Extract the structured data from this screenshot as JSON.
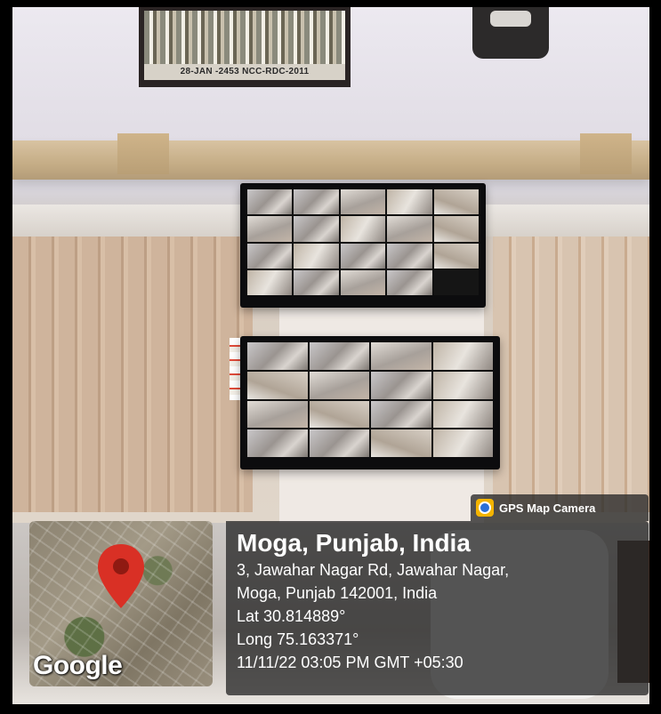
{
  "photo": {
    "frame_caption": "28-JAN -2453   NCC-RDC-2011"
  },
  "overlay": {
    "app_name": "GPS Map Camera",
    "app_icon": "gps-map-camera-icon",
    "map_attribution": "Google",
    "place": "Moga, Punjab, India",
    "address_line_1": "3, Jawahar Nagar Rd, Jawahar Nagar,",
    "address_line_2": "Moga, Punjab 142001, India",
    "latitude": "Lat 30.814889°",
    "longitude": "Long 75.163371°",
    "timestamp": "11/11/22 03:05 PM GMT +05:30"
  },
  "colors": {
    "pin": "#d93025",
    "panel": "#282828",
    "gps_icon": "#f4b400"
  }
}
